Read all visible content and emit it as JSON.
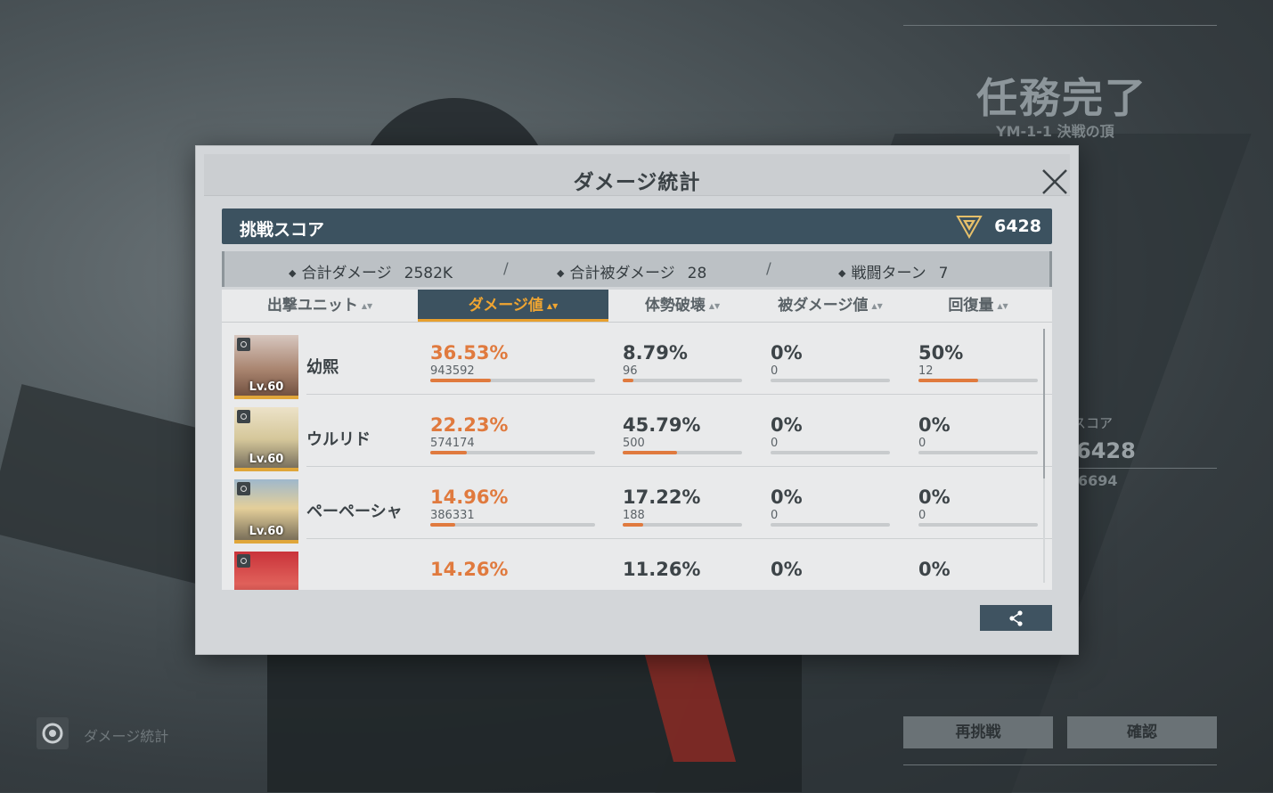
{
  "background": {
    "result_title": "任務完了",
    "result_subtitle": "YM-1-1 決戦の頂",
    "score_label": "スコア",
    "score_value": "6428",
    "best_score": "6694",
    "retry_button": "再挑戦",
    "confirm_button": "確認",
    "stats_shortcut_label": "ダメージ統計"
  },
  "modal": {
    "title": "ダメージ統計",
    "score": {
      "label": "挑戦スコア",
      "value": "6428"
    },
    "stats": [
      {
        "label": "合計ダメージ",
        "value": "2582K"
      },
      {
        "label": "合計被ダメージ",
        "value": "28"
      },
      {
        "label": "戦闘ターン",
        "value": "7"
      }
    ],
    "columns": [
      "出撃ユニット",
      "ダメージ値",
      "体勢破壊",
      "被ダメージ値",
      "回復量"
    ],
    "active_column": "ダメージ値",
    "units": [
      {
        "name": "幼熙",
        "level": "Lv.60",
        "damage": {
          "pct": "36.53%",
          "raw": "943592",
          "ratio": 0.3653
        },
        "break": {
          "pct": "8.79%",
          "raw": "96",
          "ratio": 0.0879
        },
        "taken": {
          "pct": "0%",
          "raw": "0",
          "ratio": 0
        },
        "heal": {
          "pct": "50%",
          "raw": "12",
          "ratio": 0.5
        }
      },
      {
        "name": "ウルリド",
        "level": "Lv.60",
        "damage": {
          "pct": "22.23%",
          "raw": "574174",
          "ratio": 0.2223
        },
        "break": {
          "pct": "45.79%",
          "raw": "500",
          "ratio": 0.4579
        },
        "taken": {
          "pct": "0%",
          "raw": "0",
          "ratio": 0
        },
        "heal": {
          "pct": "0%",
          "raw": "0",
          "ratio": 0
        }
      },
      {
        "name": "ペーペーシャ",
        "level": "Lv.60",
        "damage": {
          "pct": "14.96%",
          "raw": "386331",
          "ratio": 0.1496
        },
        "break": {
          "pct": "17.22%",
          "raw": "188",
          "ratio": 0.1722
        },
        "taken": {
          "pct": "0%",
          "raw": "0",
          "ratio": 0
        },
        "heal": {
          "pct": "0%",
          "raw": "0",
          "ratio": 0
        }
      },
      {
        "name": "",
        "level": "",
        "damage": {
          "pct": "14.26%",
          "raw": "",
          "ratio": 0.1426
        },
        "break": {
          "pct": "11.26%",
          "raw": "",
          "ratio": 0.1126
        },
        "taken": {
          "pct": "0%",
          "raw": "",
          "ratio": 0
        },
        "heal": {
          "pct": "0%",
          "raw": "",
          "ratio": 0
        }
      }
    ],
    "colors": {
      "accent": "#e07a3e",
      "header": "#3c5260",
      "active_text": "#f0a531"
    }
  }
}
